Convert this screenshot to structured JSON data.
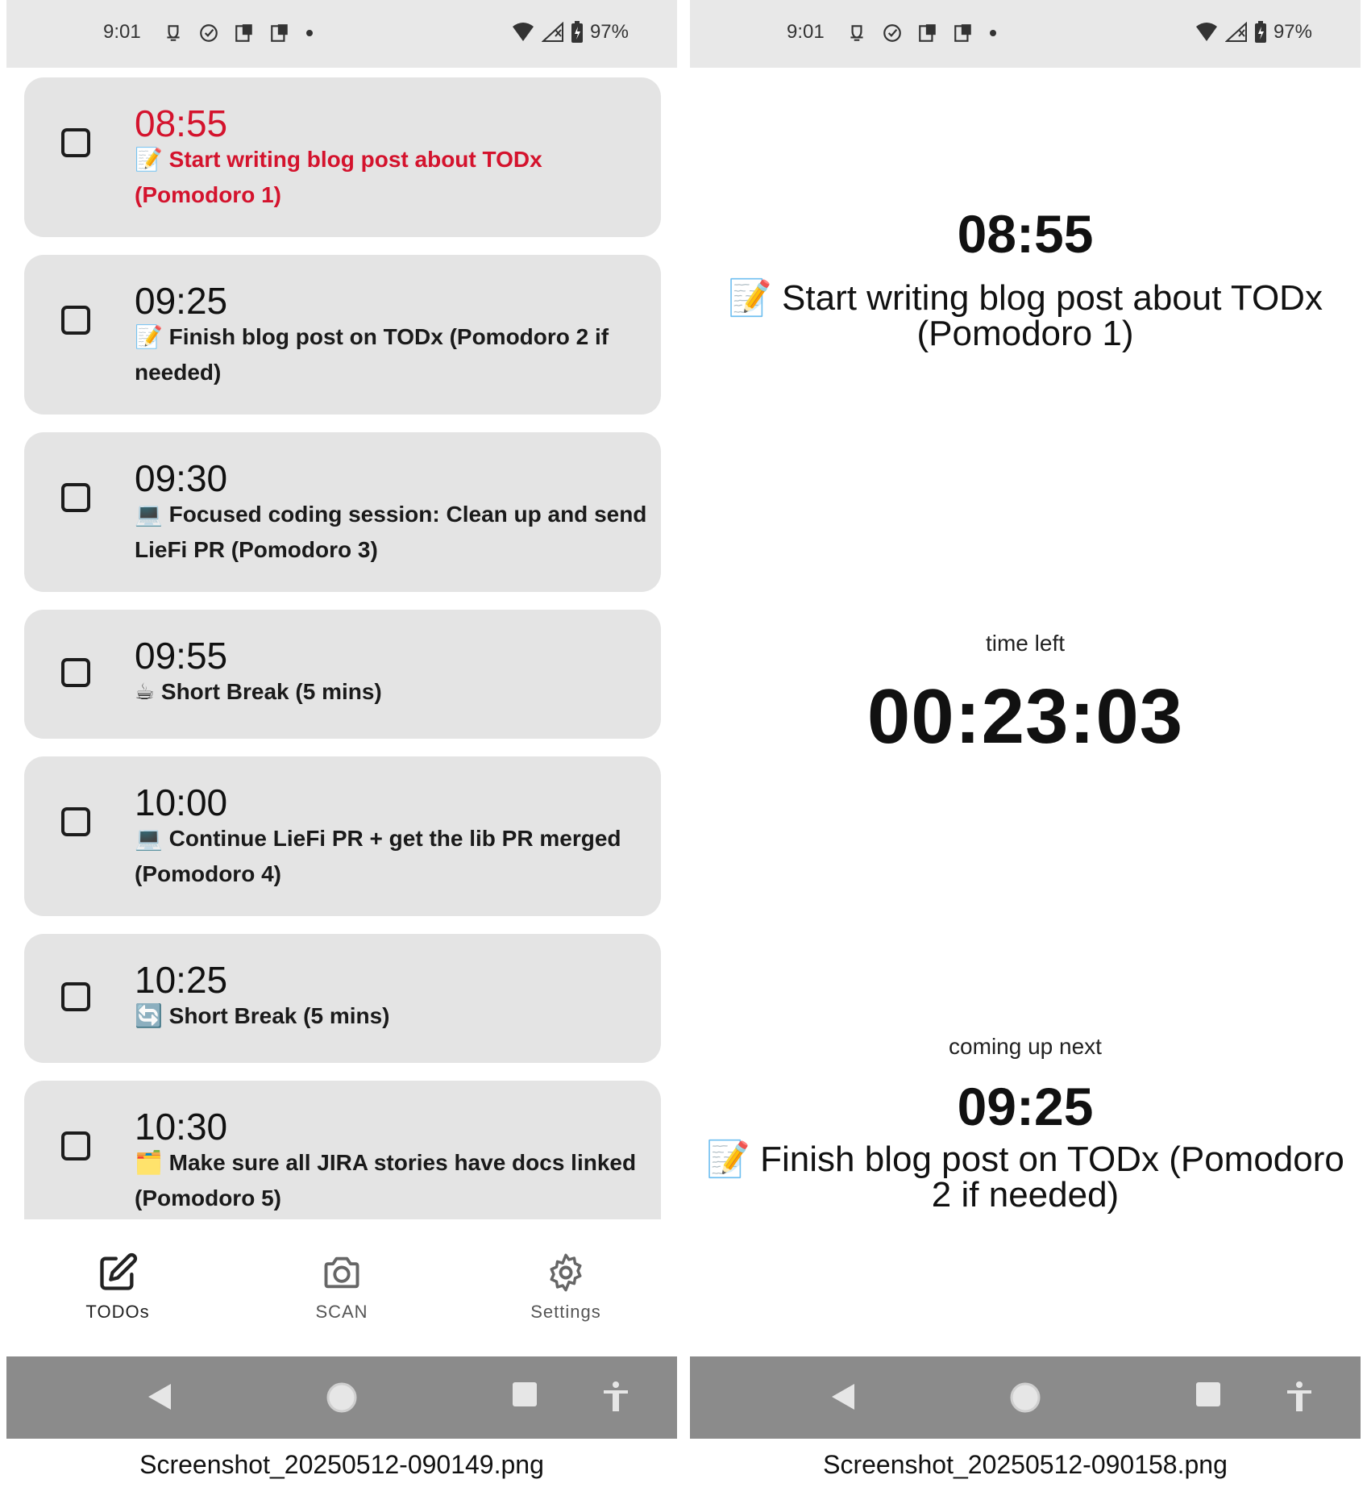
{
  "status_bar": {
    "time": "9:01",
    "battery": "97%"
  },
  "todos": [
    {
      "time": "08:55",
      "emoji": "📝",
      "text": "Start writing blog post about TODx (Pomodoro 1)",
      "active": true
    },
    {
      "time": "09:25",
      "emoji": "📝",
      "text": "Finish blog post on TODx (Pomodoro 2 if needed)",
      "active": false
    },
    {
      "time": "09:30",
      "emoji": "💻",
      "text": "Focused coding session: Clean up and send LieFi PR (Pomodoro 3)",
      "active": false
    },
    {
      "time": "09:55",
      "emoji": "☕",
      "text": "Short Break (5 mins)",
      "active": false
    },
    {
      "time": "10:00",
      "emoji": "💻",
      "text": "Continue LieFi PR + get the lib PR merged (Pomodoro 4)",
      "active": false
    },
    {
      "time": "10:25",
      "emoji": "🔄",
      "text": "Short Break (5 mins)",
      "active": false
    },
    {
      "time": "10:30",
      "emoji": "🗂️",
      "text": "Make sure all JIRA stories have docs linked (Pomodoro 5)",
      "active": false
    }
  ],
  "nav": {
    "todos_label": "TODOs",
    "scan_label": "SCAN",
    "settings_label": "Settings"
  },
  "focus": {
    "current_time": "08:55",
    "current_title": "📝 Start writing blog post about TODx (Pomodoro 1)",
    "time_left_label": "time left",
    "countdown": "00:23:03",
    "next_label": "coming up next",
    "next_time": "09:25",
    "next_title": "📝 Finish blog post on TODx (Pomodoro 2 if needed)"
  },
  "captions": {
    "left": "Screenshot_20250512-090149.png",
    "right": "Screenshot_20250512-090158.png"
  },
  "colors": {
    "active_task": "#d4132d",
    "card_bg": "#e4e4e4",
    "status_bar_bg": "#e8e8e8",
    "system_nav_bg": "#8b8b8b"
  },
  "icons": {
    "nav": [
      "edit-icon",
      "camera-icon",
      "gear-icon"
    ],
    "system_nav": [
      "back-icon",
      "home-icon",
      "recents-icon",
      "accessibility-icon"
    ]
  }
}
